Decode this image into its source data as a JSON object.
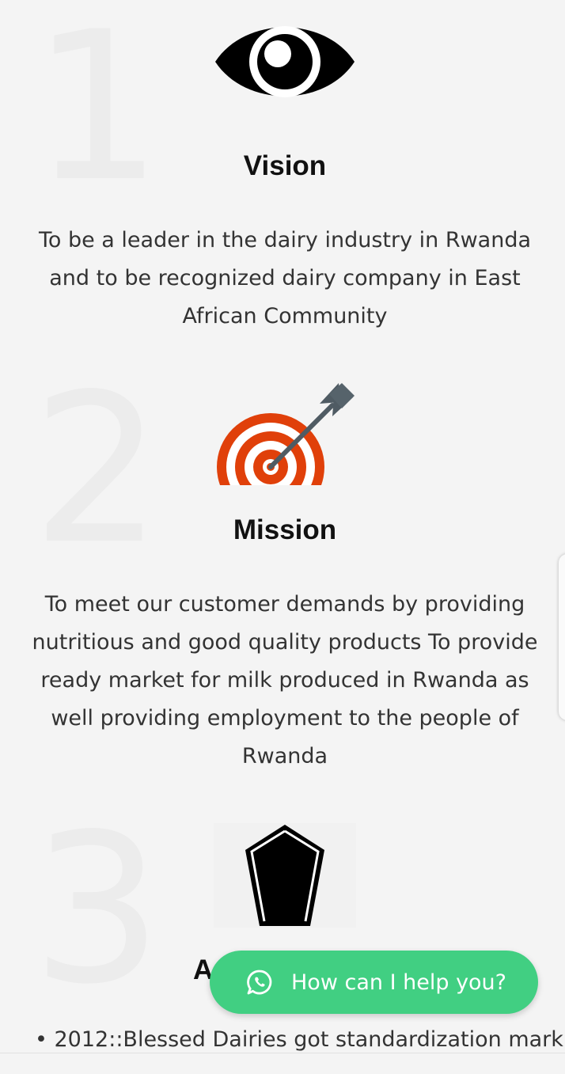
{
  "sections": [
    {
      "number": "1",
      "icon": "eye-icon",
      "title": "Vision",
      "text": "To be a leader in the dairy industry in Rwanda and to be recognized dairy company in East African Community"
    },
    {
      "number": "2",
      "icon": "target-icon",
      "title": "Mission",
      "text": "To meet our customer demands by providing nutritious and good quality products To provide ready market for milk produced in Rwanda as well providing employment to the people of Rwanda"
    },
    {
      "number": "3",
      "icon": "gem-icon",
      "title_visible": "A",
      "bullet": "• 2012::Blessed Dairies got standardization mark"
    }
  ],
  "chat_widget": {
    "label": "How can I help you?",
    "icon": "whatsapp-icon",
    "color": "#41cf82"
  },
  "colors": {
    "background": "#f4f4f4",
    "target_red": "#e0400a",
    "heading": "#111111",
    "body_text": "#333333"
  }
}
